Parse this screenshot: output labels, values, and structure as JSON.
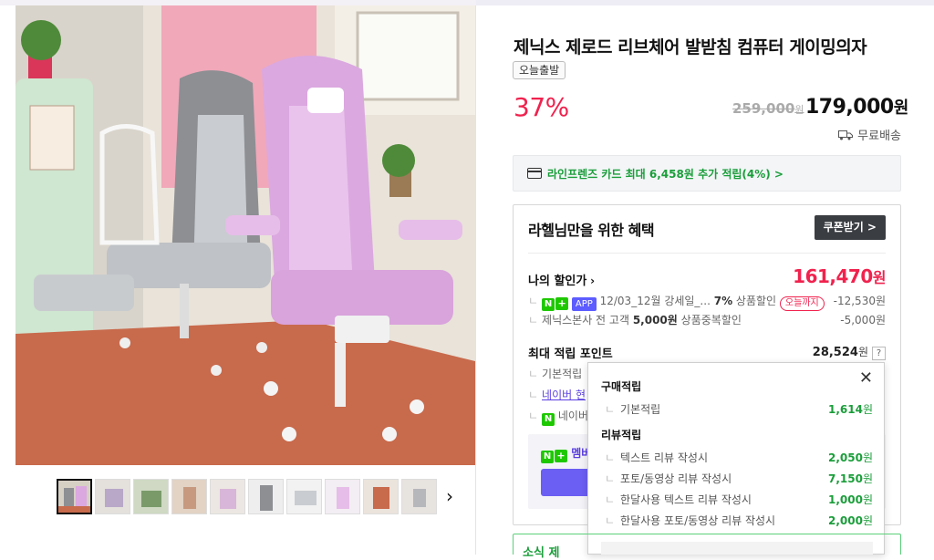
{
  "product": {
    "title": "제닉스 제로드 리브체어 발받침 컴퓨터 게이밍의자",
    "badge": "오늘출발",
    "discount": "37%",
    "original_price": "259,000",
    "original_unit": "원",
    "price": "179,000",
    "price_unit": "원",
    "shipping": "무료배송"
  },
  "card_promo": "라인프렌즈 카드 최대 6,458원 추가 적립(4%) >",
  "benefit": {
    "title": "라헬님만을 위한 혜택",
    "coupon_button": "쿠폰받기 >",
    "my_discount_label": "나의 할인가",
    "my_discount_price": "161,470",
    "my_discount_unit": "원",
    "discount_rows": [
      {
        "text": "12/03_12월 강세일_...",
        "percent": "7%",
        "desc": "상품할인",
        "tag": "오늘까지",
        "amount": "-12,530원"
      },
      {
        "text": "제닉스본사 전 고객",
        "bold": "5,000원",
        "desc": "상품중복할인",
        "amount": "-5,000원"
      }
    ],
    "points_label": "최대 적립 포인트",
    "points_value": "28,524",
    "points_unit": "원",
    "point_rows": [
      "기본적립",
      "네이버 현",
      "네이버"
    ],
    "member_label": "멤버"
  },
  "popup": {
    "purchase_title": "구매적립",
    "purchase_rows": [
      {
        "label": "기본적립",
        "value": "1,614",
        "unit": "원"
      }
    ],
    "review_title": "리뷰적립",
    "review_rows": [
      {
        "label": "텍스트 리뷰 작성시",
        "value": "2,050",
        "unit": "원"
      },
      {
        "label": "포토/동영상 리뷰 작성시",
        "value": "7,150",
        "unit": "원"
      },
      {
        "label": "한달사용 텍스트 리뷰 작성시",
        "value": "1,000",
        "unit": "원"
      },
      {
        "label": "한달사용 포토/동영상 리뷰 작성시",
        "value": "2,000",
        "unit": "원"
      }
    ]
  },
  "bottom_bar": "소식 제",
  "icons": {
    "help": "?",
    "close": "✕",
    "next": "›",
    "tree": "ㄴ"
  },
  "colors": {
    "accent_red": "#f0224e",
    "naver_green": "#1ec800",
    "point_green": "#1a9e3a",
    "purple": "#6b5ef2"
  }
}
